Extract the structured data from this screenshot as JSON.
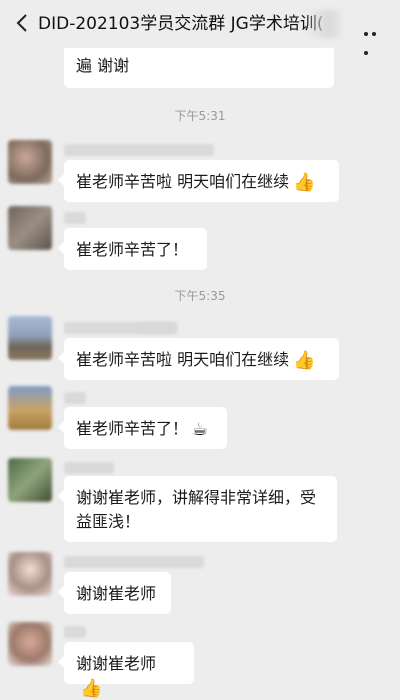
{
  "header": {
    "title": "DID-202103学员交流群 JG学术培训(",
    "back_icon": "back-chevron-icon",
    "menu_icon": "more-dots-icon"
  },
  "messages": [
    {
      "text": "遍 谢谢",
      "partial": true
    },
    {
      "timestamp": "下午5:31"
    },
    {
      "text": "崔老师辛苦啦  明天咱们在继续",
      "emoji": "👍"
    },
    {
      "text": "崔老师辛苦了！"
    },
    {
      "timestamp": "下午5:35"
    },
    {
      "text": "崔老师辛苦啦  明天咱们在继续",
      "emoji": "👍"
    },
    {
      "text": "崔老师辛苦了！",
      "emoji": "☕"
    },
    {
      "text_line1": "谢谢崔老师，讲解得非常详细，受",
      "text_line2": "益匪浅！"
    },
    {
      "text": "谢谢崔老师"
    },
    {
      "text": "谢谢崔老师",
      "emoji": "👍"
    }
  ]
}
